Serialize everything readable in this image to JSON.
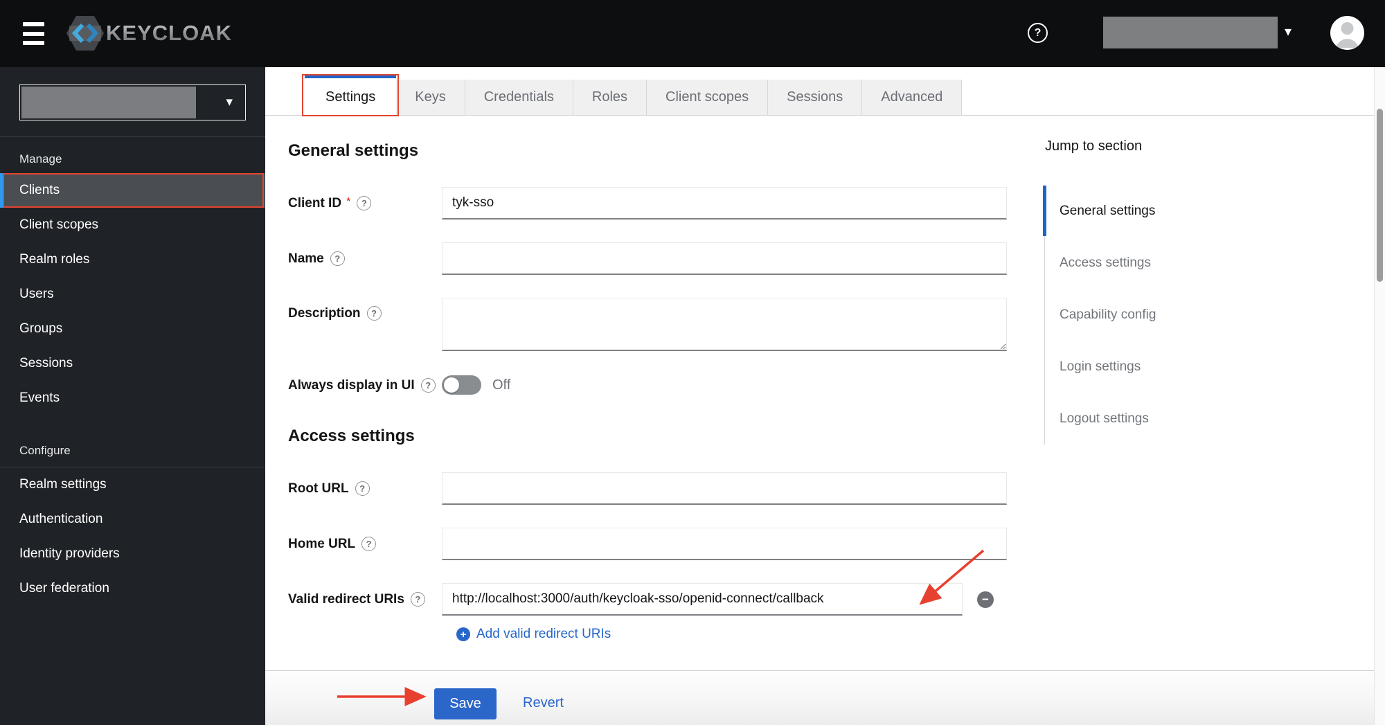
{
  "header": {
    "brand": "KEYCLOAK",
    "help_icon": "?",
    "caret": "▾"
  },
  "sidebar": {
    "realm_caret": "▾",
    "manage_label": "Manage",
    "manage_items": [
      "Clients",
      "Client scopes",
      "Realm roles",
      "Users",
      "Groups",
      "Sessions",
      "Events"
    ],
    "configure_label": "Configure",
    "configure_items": [
      "Realm settings",
      "Authentication",
      "Identity providers",
      "User federation"
    ],
    "active_item": "Clients"
  },
  "tabs": {
    "items": [
      "Settings",
      "Keys",
      "Credentials",
      "Roles",
      "Client scopes",
      "Sessions",
      "Advanced"
    ],
    "active": "Settings"
  },
  "help_icon": "?",
  "general": {
    "heading": "General settings",
    "client_id_label": "Client ID",
    "required_mark": "*",
    "client_id_value": "tyk-sso",
    "name_label": "Name",
    "name_value": "",
    "description_label": "Description",
    "description_value": "",
    "always_display_label": "Always display in UI",
    "toggle_state": "Off"
  },
  "access": {
    "heading": "Access settings",
    "root_url_label": "Root URL",
    "root_url_value": "",
    "home_url_label": "Home URL",
    "home_url_value": "",
    "redirect_label": "Valid redirect URIs",
    "redirect_value": "http://localhost:3000/auth/keycloak-sso/openid-connect/callback",
    "remove_icon": "−",
    "add_icon": "+",
    "add_redirect_label": "Add valid redirect URIs"
  },
  "jump": {
    "title": "Jump to section",
    "items": [
      "General settings",
      "Access settings",
      "Capability config",
      "Login settings",
      "Logout settings"
    ],
    "active": "General settings"
  },
  "actions": {
    "save": "Save",
    "revert": "Revert"
  },
  "annotation_color": "#e5452f"
}
